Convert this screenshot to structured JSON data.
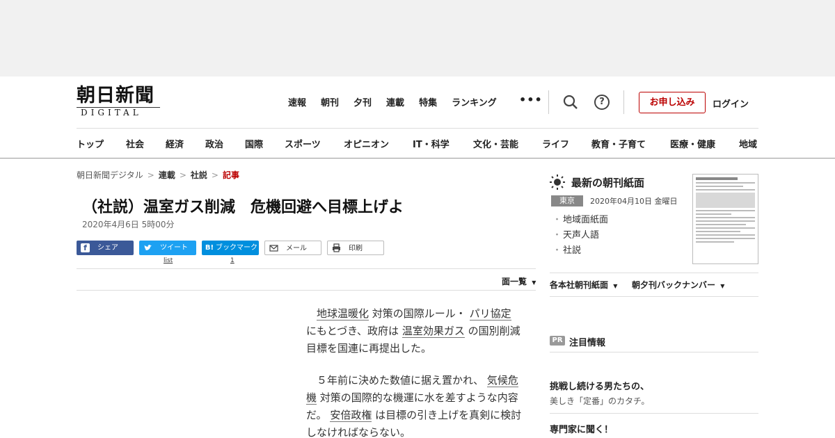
{
  "header": {
    "logo_kanji": "朝日新聞",
    "logo_sub": "DIGITAL",
    "topnav": [
      "速報",
      "朝刊",
      "夕刊",
      "連載",
      "特集",
      "ランキング"
    ],
    "more": "•••",
    "help": "?",
    "apply_label": "お申し込み",
    "login_label": "ログイン",
    "categories": [
      "トップ",
      "社会",
      "経済",
      "政治",
      "国際",
      "スポーツ",
      "オピニオン",
      "IT・科学",
      "文化・芸能",
      "ライフ",
      "教育・子育て",
      "医療・健康",
      "地域"
    ],
    "accent_color": "#bb0000"
  },
  "breadcrumb": {
    "items": [
      "朝日新聞デジタル",
      "連載",
      "社説"
    ],
    "current": "記事",
    "separator": ">"
  },
  "article": {
    "title": "（社説）温室ガス削減　危機回避へ目標上げよ",
    "date": "2020年4月6日 5時00分",
    "share": {
      "facebook": "シェア",
      "twitter": "ツイート",
      "hatena": "ブックマーク",
      "hatena_icon": "B!",
      "mail": "メール",
      "print": "印刷",
      "twitter_count": "list",
      "hatena_count": "1"
    },
    "page_list": "面一覧",
    "p1": [
      "地球温暖化",
      " 対策の国際ルール・ ",
      "パリ協定",
      " にもとづき、政府は ",
      "温室効果ガス",
      " の国別削減目標を国連に再提出した。"
    ],
    "p2": [
      "５年前に決めた数値に据え置かれ、 ",
      "気候危機",
      " 対策の国際的な機運に水を差すような内容だ。 ",
      "安倍政権",
      " は目標の引き上げを真剣に検討しなければならない。"
    ]
  },
  "sidebar": {
    "title": "最新の朝刊紙面",
    "region": "東京",
    "date": "2020年04月10日 金曜日",
    "links": [
      "地域面紙面",
      "天声人語",
      "社説"
    ],
    "dropdown1": "各本社朝刊紙面",
    "dropdown2": "朝夕刊バックナンバー",
    "pr_badge": "PR",
    "pr_title": "注目情報",
    "pr1_title": "挑戦し続ける男たちの、",
    "pr1_sub": "美しき「定番」のカタチ。",
    "pr2_title": "専門家に聞く！"
  }
}
